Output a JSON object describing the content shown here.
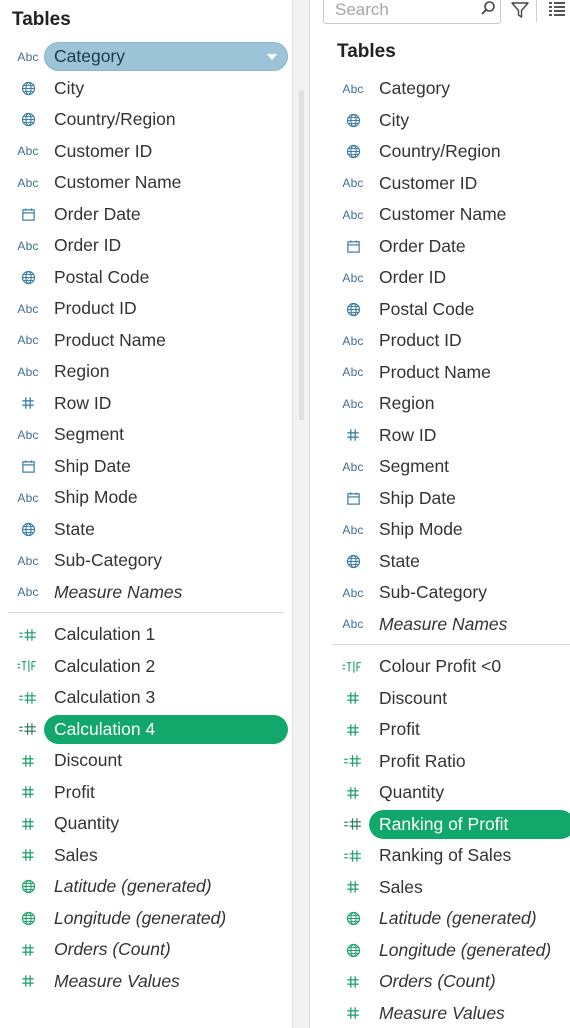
{
  "left_panel": {
    "title": "Tables",
    "dimensions": [
      {
        "label": "Category",
        "icon": "abc-string-icon",
        "selected": true
      },
      {
        "label": "City",
        "icon": "globe-icon"
      },
      {
        "label": "Country/Region",
        "icon": "globe-icon"
      },
      {
        "label": "Customer ID",
        "icon": "abc-string-icon"
      },
      {
        "label": "Customer Name",
        "icon": "abc-string-icon"
      },
      {
        "label": "Order Date",
        "icon": "calendar-icon"
      },
      {
        "label": "Order ID",
        "icon": "abc-string-icon"
      },
      {
        "label": "Postal Code",
        "icon": "globe-icon"
      },
      {
        "label": "Product ID",
        "icon": "abc-string-icon"
      },
      {
        "label": "Product Name",
        "icon": "abc-string-icon"
      },
      {
        "label": "Region",
        "icon": "abc-string-icon"
      },
      {
        "label": "Row ID",
        "icon": "hash-icon"
      },
      {
        "label": "Segment",
        "icon": "abc-string-icon"
      },
      {
        "label": "Ship Date",
        "icon": "calendar-icon"
      },
      {
        "label": "Ship Mode",
        "icon": "abc-string-icon"
      },
      {
        "label": "State",
        "icon": "globe-icon"
      },
      {
        "label": "Sub-Category",
        "icon": "abc-string-icon"
      },
      {
        "label": "Measure Names",
        "icon": "abc-string-icon",
        "italic": true
      }
    ],
    "measures": [
      {
        "label": "Calculation 1",
        "icon": "calc-number-icon"
      },
      {
        "label": "Calculation 2",
        "icon": "calc-boolean-icon"
      },
      {
        "label": "Calculation 3",
        "icon": "calc-number-icon"
      },
      {
        "label": "Calculation 4",
        "icon": "calc-number-icon",
        "selected": true
      },
      {
        "label": "Discount",
        "icon": "hash-measure-icon"
      },
      {
        "label": "Profit",
        "icon": "hash-measure-icon"
      },
      {
        "label": "Quantity",
        "icon": "hash-measure-icon"
      },
      {
        "label": "Sales",
        "icon": "hash-measure-icon"
      },
      {
        "label": "Latitude (generated)",
        "icon": "globe-measure-icon",
        "italic": true
      },
      {
        "label": "Longitude (generated)",
        "icon": "globe-measure-icon",
        "italic": true
      },
      {
        "label": "Orders (Count)",
        "icon": "hash-measure-icon",
        "italic": true
      },
      {
        "label": "Measure Values",
        "icon": "hash-measure-icon",
        "italic": true
      }
    ]
  },
  "right_panel": {
    "title": "Tables",
    "search": {
      "placeholder": "Search"
    },
    "dimensions": [
      {
        "label": "Category",
        "icon": "abc-string-icon"
      },
      {
        "label": "City",
        "icon": "globe-icon"
      },
      {
        "label": "Country/Region",
        "icon": "globe-icon"
      },
      {
        "label": "Customer ID",
        "icon": "abc-string-icon"
      },
      {
        "label": "Customer Name",
        "icon": "abc-string-icon"
      },
      {
        "label": "Order Date",
        "icon": "calendar-icon"
      },
      {
        "label": "Order ID",
        "icon": "abc-string-icon"
      },
      {
        "label": "Postal Code",
        "icon": "globe-icon"
      },
      {
        "label": "Product ID",
        "icon": "abc-string-icon"
      },
      {
        "label": "Product Name",
        "icon": "abc-string-icon"
      },
      {
        "label": "Region",
        "icon": "abc-string-icon"
      },
      {
        "label": "Row ID",
        "icon": "hash-icon"
      },
      {
        "label": "Segment",
        "icon": "abc-string-icon"
      },
      {
        "label": "Ship Date",
        "icon": "calendar-icon"
      },
      {
        "label": "Ship Mode",
        "icon": "abc-string-icon"
      },
      {
        "label": "State",
        "icon": "globe-icon"
      },
      {
        "label": "Sub-Category",
        "icon": "abc-string-icon"
      },
      {
        "label": "Measure Names",
        "icon": "abc-string-icon",
        "italic": true
      }
    ],
    "measures": [
      {
        "label": "Colour Profit <0",
        "icon": "calc-boolean-icon"
      },
      {
        "label": "Discount",
        "icon": "hash-measure-icon"
      },
      {
        "label": "Profit",
        "icon": "hash-measure-icon"
      },
      {
        "label": "Profit Ratio",
        "icon": "calc-number-icon"
      },
      {
        "label": "Quantity",
        "icon": "hash-measure-icon"
      },
      {
        "label": "Ranking of Profit",
        "icon": "calc-number-icon",
        "selected": true
      },
      {
        "label": "Ranking of Sales",
        "icon": "calc-number-icon"
      },
      {
        "label": "Sales",
        "icon": "hash-measure-icon"
      },
      {
        "label": "Latitude (generated)",
        "icon": "globe-measure-icon",
        "italic": true
      },
      {
        "label": "Longitude (generated)",
        "icon": "globe-measure-icon",
        "italic": true
      },
      {
        "label": "Orders (Count)",
        "icon": "hash-measure-icon",
        "italic": true
      },
      {
        "label": "Measure Values",
        "icon": "hash-measure-icon",
        "italic": true
      }
    ]
  },
  "colors": {
    "dimension_icon": "#3d7ea6",
    "measure_icon": "#20a36a",
    "dimension_selected": "#9dc3d6",
    "measure_selected": "#13a86b"
  }
}
